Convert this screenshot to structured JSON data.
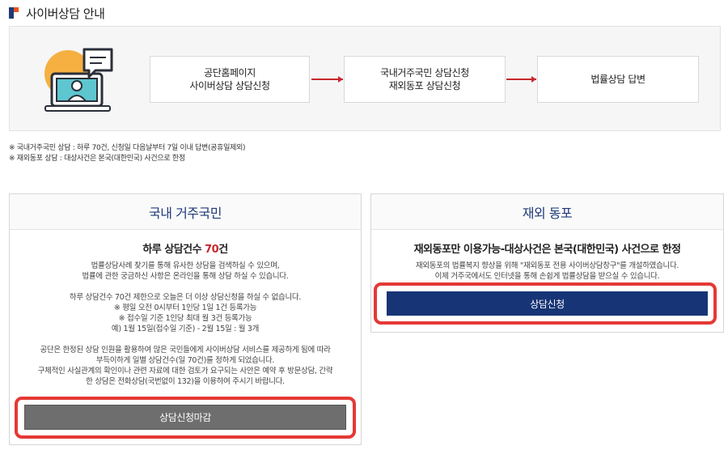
{
  "page": {
    "title": "사이버상담 안내"
  },
  "flow": {
    "steps": [
      {
        "line1": "공단홈페이지",
        "line2": "사이버상담 상담신청"
      },
      {
        "line1": "국내거주국민 상담신청",
        "line2": "재외동포 상담신청"
      },
      {
        "line1": "법률상담 답변",
        "line2": ""
      }
    ]
  },
  "notes": [
    "※ 국내거주국민 상담 : 하루 70건, 신청일 다음날부터 7일 이내 답변(공휴일제외)",
    "※ 재외동포 상담 : 대상사건은 본국(대한민국) 사건으로 한정"
  ],
  "domestic": {
    "header": "국내 거주국민",
    "subhead_prefix": "하루 상담건수 ",
    "subhead_count": "70",
    "subhead_suffix": "건",
    "para1": [
      "법률상담사례 찾기를 통해 유사한 상담을 검색하실 수 있으며,",
      "법률에 관한 궁금하신 사항은 온라인을 통해 상담 하실 수 있습니다."
    ],
    "para2": [
      "하루 상담건수 70건 제한으로 오늘은 더 이상 상담신청을 하실 수 없습니다.",
      "※ 평일 오전 0시부터 1인당 1일 1건 등록가능",
      "※ 접수일 기준 1인당 최대 월 3건 등록가능",
      "예) 1월 15일(접수일 기준) - 2월 15일 : 월 3개"
    ],
    "para3": [
      "공단은 한정된 상담 인원을 활용하여 많은 국민들에게 사이버상담 서비스를 제공하게 됨에 따라",
      "부득이하게 일별 상담건수(일 70건)를 정하게 되었습니다.",
      "구체적인 사실관계의 확인이나 관련 자료에 대한 검토가 요구되는 사안은 예약 후 방문상담, 간략",
      "한 상담은 전화상담(국번없이 132)을 이용하여 주시기 바랍니다."
    ],
    "button_label": "상담신청마감"
  },
  "overseas": {
    "header": "재외 동포",
    "subhead": "재외동포만 이용가능-대상사건은 본국(대한민국) 사건으로 한정",
    "para": [
      "재외동포의 법률복지 향상을 위해 \"재외동포 전용 사이버상담창구\"를 개설하였습니다.",
      "이제 거주국에서도 인터넷을 통해 손쉽게 법률상담을 받으실 수 있습니다."
    ],
    "button_label": "상담신청"
  },
  "colors": {
    "navy": "#173476",
    "accent_red": "#c8282d",
    "highlight_red": "#e53935",
    "closed_gray": "#6e6e6e"
  }
}
